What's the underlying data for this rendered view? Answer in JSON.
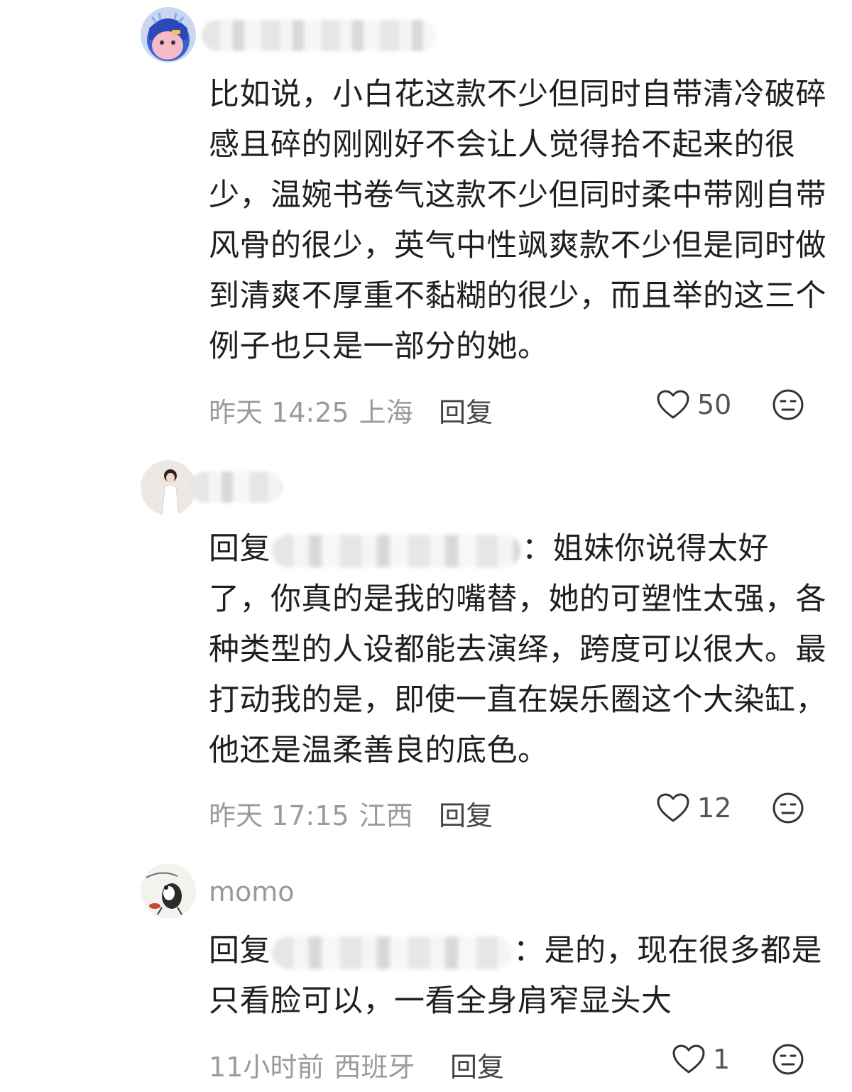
{
  "comments": [
    {
      "username": "",
      "reply_prefix": "",
      "text": "比如说，小白花这款不少但同时自带清冷破碎感且碎的刚刚好不会让人觉得拾不起来的很少，温婉书卷气这款不少但同时柔中带刚自带风骨的很少，英气中性飒爽款不少但是同时做到清爽不厚重不黏糊的很少，而且举的这三个例子也只是一部分的她。",
      "time": "昨天 14:25",
      "location": "上海",
      "reply_label": "回复",
      "likes": "50",
      "like_icon": "heart-outline-icon",
      "dislike_icon": "meh-face-icon"
    },
    {
      "username": "",
      "reply_prefix": "回复",
      "text": "：姐妹你说得太好了，你真的是我的嘴替，她的可塑性太强，各种类型的人设都能去演绎，跨度可以很大。最打动我的是，即使一直在娱乐圈这个大染缸，他还是温柔善良的底色。",
      "time": "昨天 17:15",
      "location": "江西",
      "reply_label": "回复",
      "likes": "12",
      "like_icon": "heart-outline-icon",
      "dislike_icon": "meh-face-icon"
    },
    {
      "username": "momo",
      "reply_prefix": "回复",
      "text": "：是的，现在很多都是只看脸可以，一看全身肩窄显头大",
      "time": "11小时前",
      "location": "西班牙",
      "reply_label": "回复",
      "likes": "1",
      "like_icon": "heart-outline-icon",
      "dislike_icon": "meh-face-icon"
    }
  ],
  "colors": {
    "text": "#1f1f1f",
    "meta": "#9b9b9b",
    "reply": "#444444"
  }
}
